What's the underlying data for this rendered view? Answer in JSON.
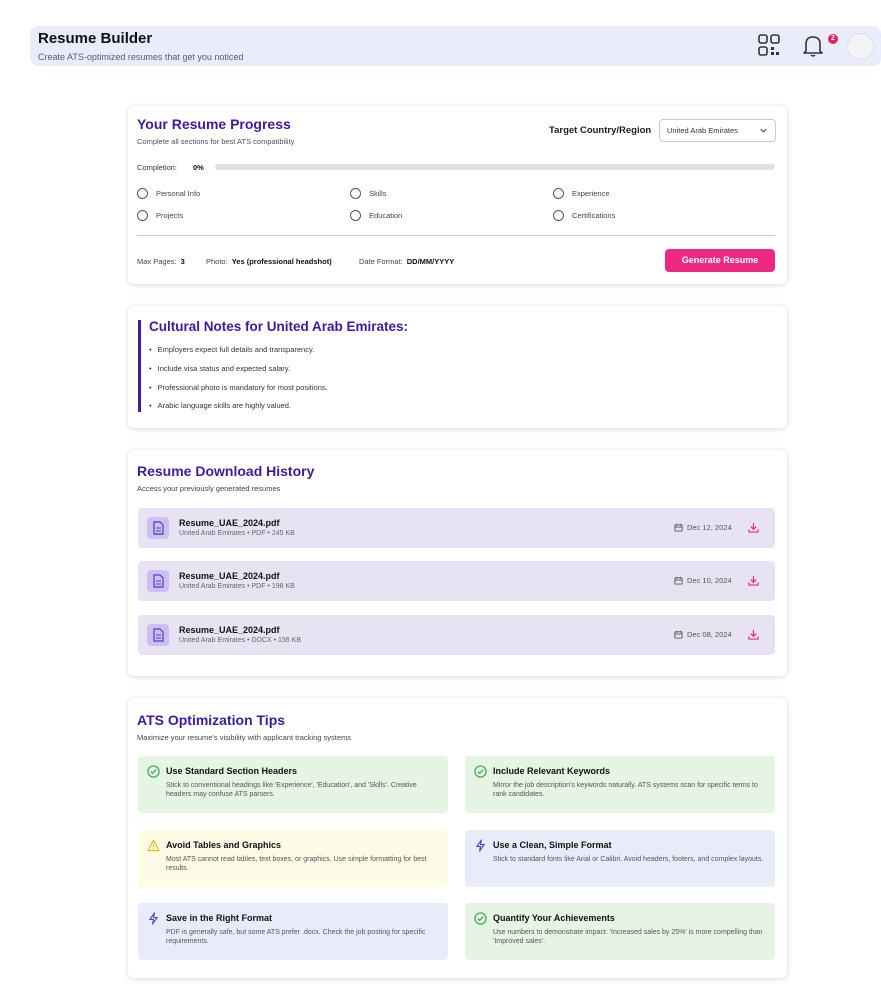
{
  "header": {
    "title": "Resume Builder",
    "subtitle": "Create ATS-optimized resumes that get you noticed",
    "notification_count": "2"
  },
  "progress": {
    "title": "Your Resume Progress",
    "subtitle": "Complete all sections for best ATS compatibility",
    "target_label": "Target Country/Region",
    "target_value": "United Arab Emirates",
    "completion_label": "Completion:",
    "completion_value": "0%",
    "completion_fraction": 0,
    "sections": [
      "Personal Info",
      "Skills",
      "Experience",
      "Projects",
      "Education",
      "Certifications"
    ],
    "max_pages_label": "Max Pages:",
    "max_pages_value": "3",
    "photo_label": "Photo:",
    "photo_value": "Yes (professional headshot)",
    "date_format_label": "Date Format:",
    "date_format_value": "DD/MM/YYYY",
    "generate_label": "Generate Resume"
  },
  "cultural": {
    "title": "Cultural Notes for United Arab Emirates:",
    "items": [
      "Employers expect full details and transparency.",
      "Include visa status and expected salary.",
      "Professional photo is mandatory for most positions.",
      "Arabic language skills are highly valued."
    ]
  },
  "history": {
    "title": "Resume Download History",
    "subtitle": "Access your previously generated resumes",
    "files": [
      {
        "name": "Resume_UAE_2024.pdf",
        "meta": "United Arab Emirates • PDF • 245 KB",
        "date": "Dec 12, 2024"
      },
      {
        "name": "Resume_UAE_2024.pdf",
        "meta": "United Arab Emirates • PDF • 198 KB",
        "date": "Dec 10, 2024"
      },
      {
        "name": "Resume_UAE_2024.pdf",
        "meta": "United Arab Emirates • DOCX • 156 KB",
        "date": "Dec 08, 2024"
      }
    ]
  },
  "tips": {
    "title": "ATS Optimization Tips",
    "subtitle": "Maximize your resume's visibility with applicant tracking systems",
    "items": [
      {
        "title": "Use Standard Section Headers",
        "text": "Stick to conventional headings like 'Experience', 'Education', and 'Skills'. Creative headers may confuse ATS parsers.",
        "icon": "check-circle-icon",
        "tone": "green"
      },
      {
        "title": "Include Relevant Keywords",
        "text": "Mirror the job description's keywords naturally. ATS systems scan for specific terms to rank candidates.",
        "icon": "check-circle-icon",
        "tone": "green"
      },
      {
        "title": "Avoid Tables and Graphics",
        "text": "Most ATS cannot read tables, text boxes, or graphics. Use simple formatting for best results.",
        "icon": "warning-icon",
        "tone": "yellow"
      },
      {
        "title": "Use a Clean, Simple Format",
        "text": "Stick to standard fonts like Arial or Calibri. Avoid headers, footers, and complex layouts.",
        "icon": "lightning-icon",
        "tone": "blue"
      },
      {
        "title": "Save in the Right Format",
        "text": "PDF is generally safe, but some ATS prefer .docx. Check the job posting for specific requirements.",
        "icon": "lightning-icon",
        "tone": "blue"
      },
      {
        "title": "Quantify Your Achievements",
        "text": "Use numbers to demonstrate impact: 'Increased sales by 25%' is more compelling than 'Improved sales'.",
        "icon": "check-circle-icon",
        "tone": "green"
      }
    ]
  },
  "colors": {
    "accent": "#3d1a9e",
    "primary_button": "#ec2a7f",
    "success": "#3aa655",
    "warning": "#e6b800",
    "info": "#4a3fbf"
  }
}
